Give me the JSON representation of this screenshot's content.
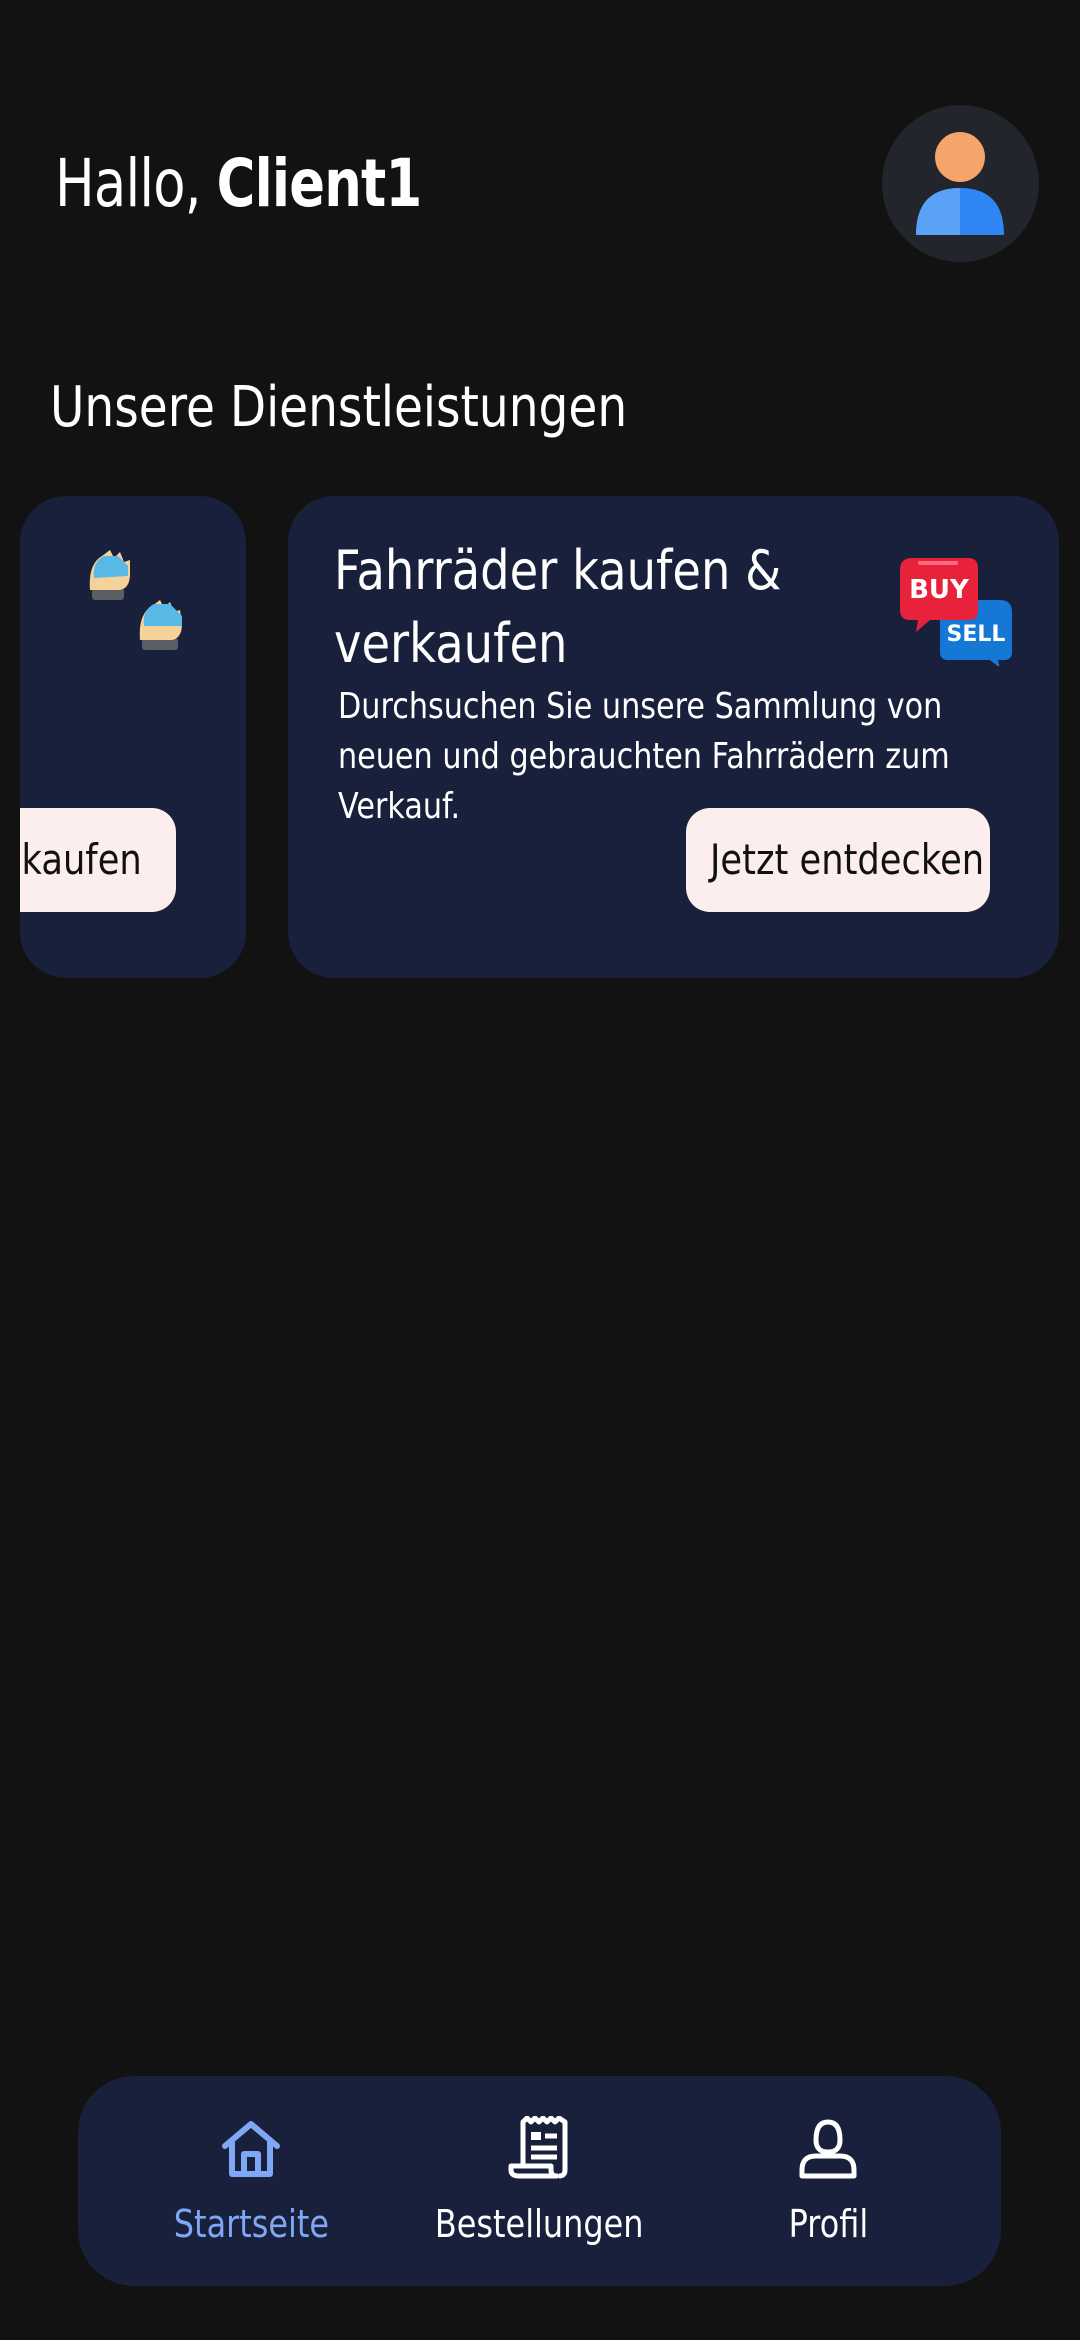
{
  "header": {
    "greeting_prefix": "Hallo,",
    "user_name": "Client1"
  },
  "services": {
    "title": "Unsere Dienstleistungen",
    "cards": [
      {
        "icon": "gloves-icon",
        "button_label": "Jetzt kaufen"
      },
      {
        "title": "Fahrräder kaufen & verkaufen",
        "description": "Durchsuchen Sie unsere Sammlung von neuen und gebrauchten Fahrrädern zum Verkauf.",
        "icon": "buy-sell-icon",
        "icon_text_buy": "BUY",
        "icon_text_sell": "SELL",
        "button_label": "Jetzt entdecken"
      }
    ]
  },
  "bottom_nav": {
    "items": [
      {
        "label": "Startseite",
        "icon": "home-icon",
        "active": true
      },
      {
        "label": "Bestellungen",
        "icon": "receipt-icon",
        "active": false
      },
      {
        "label": "Profil",
        "icon": "user-icon",
        "active": false
      }
    ]
  },
  "colors": {
    "background": "#121212",
    "card": "#18203b",
    "button": "#fdeeee",
    "active_nav": "#7fa7f4",
    "buy_red": "#e8223a",
    "sell_blue": "#1478d4"
  }
}
